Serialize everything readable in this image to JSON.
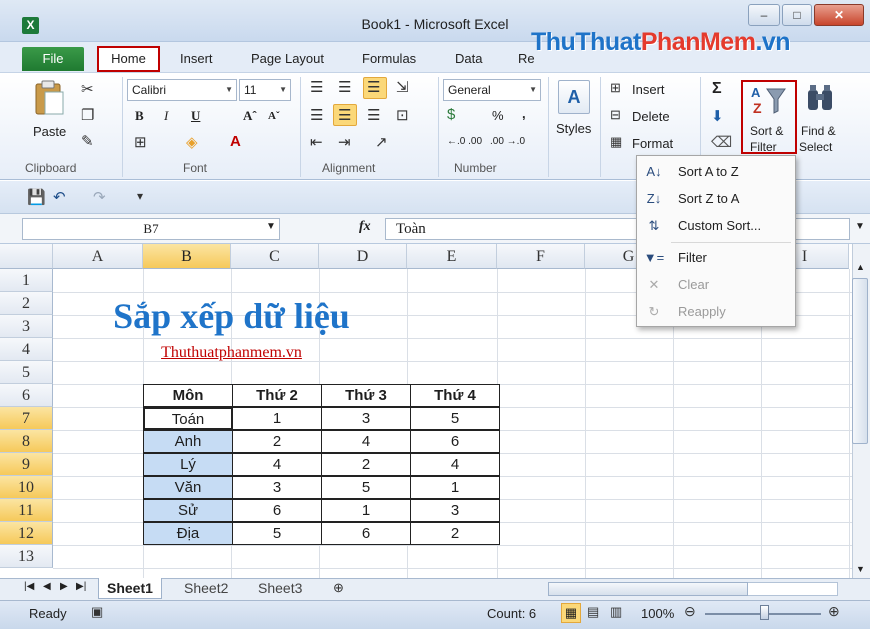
{
  "window": {
    "title": "Book1  -  Microsoft Excel",
    "app_icon": "X",
    "minimize": "–",
    "maximize": "□",
    "close": "✕"
  },
  "watermark": {
    "part1": "ThuThuat",
    "part2": "PhanMem",
    "part3": ".vn"
  },
  "tabs": {
    "file": "File",
    "home": "Home",
    "insert": "Insert",
    "page_layout": "Page Layout",
    "formulas": "Formulas",
    "data": "Data",
    "review_partial": "Re"
  },
  "ribbon": {
    "clipboard": {
      "paste": "Paste",
      "label": "Clipboard"
    },
    "font": {
      "name": "Calibri",
      "size": "11",
      "bold": "B",
      "italic": "I",
      "underline": "U",
      "grow": "Aˆ",
      "shrink": "Aˇ",
      "label": "Font"
    },
    "alignment": {
      "label": "Alignment"
    },
    "number": {
      "format": "General",
      "percent": "%",
      "comma": ",",
      "inc_dec": "←.0 .00",
      "dec_dec": ".00 →.0",
      "label": "Number"
    },
    "styles": {
      "label": "Styles"
    },
    "cells": {
      "insert": "Insert",
      "delete": "Delete",
      "format": "Format"
    },
    "editing": {
      "sigma": "Σ",
      "sort_filter": "Sort &",
      "sort_filter2": "Filter",
      "find_select": "Find &",
      "find_select2": "Select"
    }
  },
  "formula_bar": {
    "cell_ref": "B7",
    "fx": "fx",
    "value": "Toàn"
  },
  "columns": [
    "A",
    "B",
    "C",
    "D",
    "E",
    "F",
    "G",
    "H",
    "I"
  ],
  "rows": [
    "1",
    "2",
    "3",
    "4",
    "5",
    "6",
    "7",
    "8",
    "9",
    "10",
    "11",
    "12",
    "13"
  ],
  "sheet_title": "Sắp xếp dữ liệu",
  "sheet_link": "Thuthuatphanmem.vn",
  "table": {
    "headers": [
      "Môn",
      "Thứ 2",
      "Thứ 3",
      "Thứ 4"
    ],
    "rows": [
      [
        "Toán",
        "1",
        "3",
        "5"
      ],
      [
        "Anh",
        "2",
        "4",
        "6"
      ],
      [
        "Lý",
        "4",
        "2",
        "4"
      ],
      [
        "Văn",
        "3",
        "5",
        "1"
      ],
      [
        "Sử",
        "6",
        "1",
        "3"
      ],
      [
        "Địa",
        "5",
        "6",
        "2"
      ]
    ]
  },
  "dropdown": {
    "items": [
      {
        "label": "Sort A to Z",
        "enabled": true
      },
      {
        "label": "Sort Z to A",
        "enabled": true
      },
      {
        "label": "Custom Sort...",
        "enabled": true
      },
      {
        "label": "Filter",
        "enabled": true
      },
      {
        "label": "Clear",
        "enabled": false
      },
      {
        "label": "Reapply",
        "enabled": false
      }
    ]
  },
  "sheets": [
    "Sheet1",
    "Sheet2",
    "Sheet3"
  ],
  "status": {
    "ready": "Ready",
    "count": "Count: 6",
    "zoom": "100%"
  },
  "colors": {
    "title_blue": "#1f74c9",
    "link_red": "#c00000",
    "highlight_box": "#c00000",
    "selection": "#c6dcf4"
  }
}
